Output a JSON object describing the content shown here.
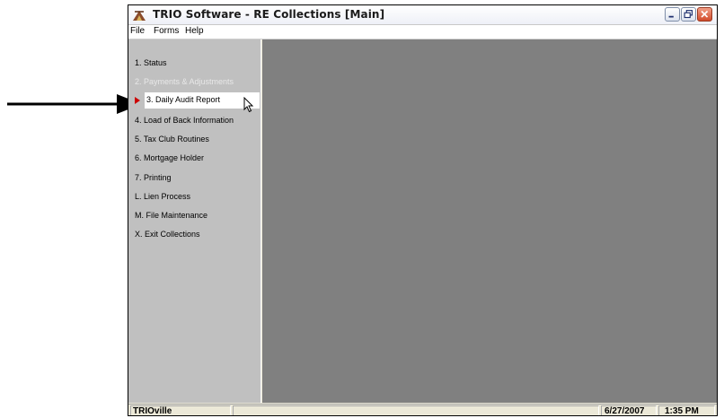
{
  "window": {
    "title": "TRIO Software - RE Collections  [Main]"
  },
  "menu": [
    "File",
    "Forms",
    "Help"
  ],
  "sidebar": {
    "items": [
      {
        "label": "1. Status",
        "state": "normal"
      },
      {
        "label": "2. Payments & Adjustments",
        "state": "disabled"
      },
      {
        "label": "3. Daily Audit Report",
        "state": "selected"
      },
      {
        "label": "4. Load of Back Information",
        "state": "normal"
      },
      {
        "label": "5. Tax Club Routines",
        "state": "normal"
      },
      {
        "label": "6. Mortgage Holder",
        "state": "normal"
      },
      {
        "label": "7. Printing",
        "state": "normal"
      },
      {
        "label": "L. Lien Process",
        "state": "normal"
      },
      {
        "label": "M. File Maintenance",
        "state": "normal"
      },
      {
        "label": "X. Exit Collections",
        "state": "normal"
      }
    ]
  },
  "statusbar": {
    "town": "TRIOville",
    "date": "6/27/2007",
    "time": "1:35 PM"
  },
  "colors": {
    "workspace": "#808080",
    "sidebar": "#c0c0c0",
    "selection_marker": "#cc0000"
  }
}
